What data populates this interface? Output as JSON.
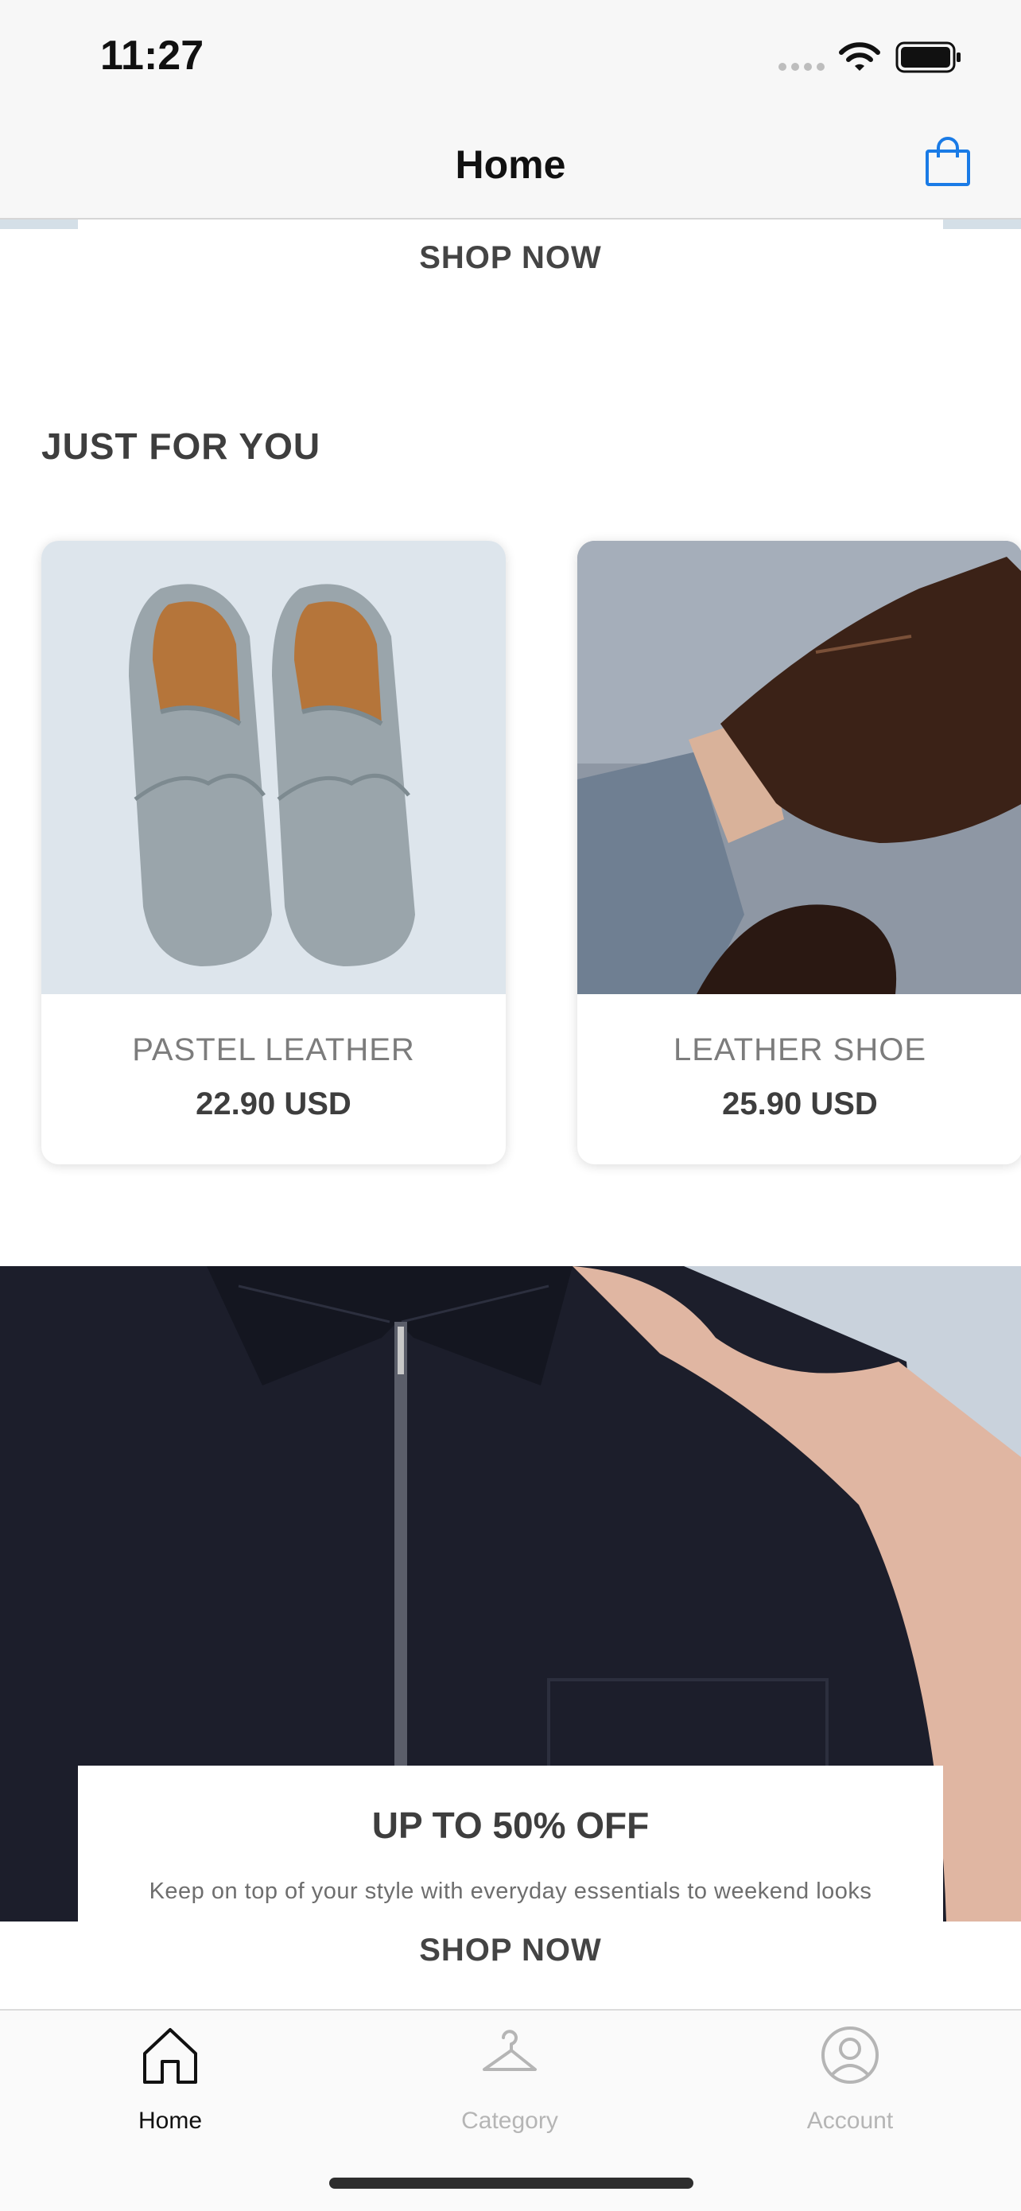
{
  "status_bar": {
    "time": "11:27"
  },
  "nav": {
    "title": "Home"
  },
  "top_banner": {
    "shop_now_label": "SHOP NOW"
  },
  "section": {
    "title": "JUST FOR YOU"
  },
  "products": [
    {
      "name": "PASTEL LEATHER",
      "price": "22.90 USD"
    },
    {
      "name": "LEATHER SHOE",
      "price": "25.90 USD"
    }
  ],
  "promo": {
    "title": "UP TO 50% OFF",
    "subtitle": "Keep on top of your style with everyday essentials to weekend looks",
    "shop_now_label": "SHOP NOW"
  },
  "tabs": [
    {
      "label": "Home",
      "icon": "home-icon",
      "active": true
    },
    {
      "label": "Category",
      "icon": "hanger-icon",
      "active": false
    },
    {
      "label": "Account",
      "icon": "account-icon",
      "active": false
    }
  ],
  "colors": {
    "accent": "#1a7be6",
    "active_tab": "#111111",
    "inactive_tab": "#b5b5b5"
  }
}
